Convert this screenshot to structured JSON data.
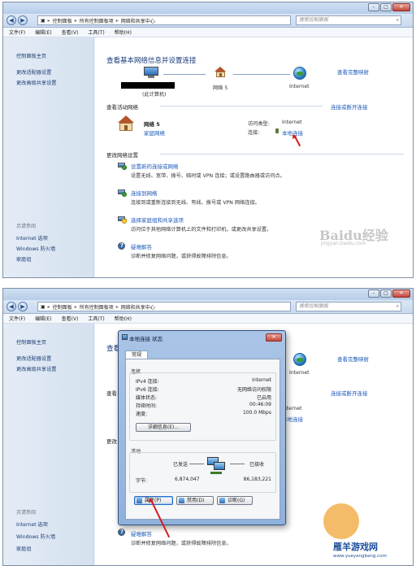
{
  "breadcrumb": [
    "控制面板",
    "所有控制面板项",
    "网络和共享中心"
  ],
  "search_placeholder": "搜索控制面板",
  "menu": [
    "文件(F)",
    "编辑(E)",
    "查看(V)",
    "工具(T)",
    "帮助(H)"
  ],
  "sidebar": {
    "home": "控制面板主页",
    "adapter_settings": "更改适配器设置",
    "advanced_sharing": "更改高级共享设置",
    "see_also_title": "另请参阅",
    "see_also": [
      "Internet 选项",
      "Windows 防火墙",
      "家庭组"
    ]
  },
  "main": {
    "heading": "查看基本网络信息并设置连接",
    "full_map": "查看完整映射",
    "map_nodes": [
      "(此计算机)",
      "网络 5",
      "Internet"
    ],
    "active_networks_title": "查看活动网络",
    "connect_disconnect": "连接或断开连接",
    "network_name": "网络 5",
    "network_type": "家庭网络",
    "access_type_label": "访问类型:",
    "access_type_value": "Internet",
    "connection_label": "连接:",
    "connection_value": "本地连接",
    "change_settings_title": "更改网络设置",
    "tasks": [
      {
        "title": "设置新的连接或网络",
        "desc": "设置无线、宽带、拨号、临时或 VPN 连接；或设置路由器或访问点。"
      },
      {
        "title": "连接到网络",
        "desc": "连接到或重新连接到无线、有线、拨号或 VPN 网络连接。"
      },
      {
        "title": "选择家庭组和共享选项",
        "desc": "访问位于其他网络计算机上的文件和打印机，或更改共享设置。"
      },
      {
        "title": "疑难解答",
        "desc": "诊断并修复网络问题，或获得故障排除信息。"
      }
    ]
  },
  "main2": {
    "heading_partial": "查看",
    "active_partial": "查看",
    "change_partial": "更改"
  },
  "dialog": {
    "title": "本地连接 状态",
    "tab": "常规",
    "connection_group": "连接",
    "rows": [
      {
        "label": "IPv4 连接:",
        "value": "Internet"
      },
      {
        "label": "IPv6 连接:",
        "value": "无网络访问权限"
      },
      {
        "label": "媒体状态:",
        "value": "已启用"
      },
      {
        "label": "持续时间:",
        "value": "00:46:09"
      },
      {
        "label": "速度:",
        "value": "100.0 Mbps"
      }
    ],
    "details_button": "详细信息(E)...",
    "activity_group": "活动",
    "sent_label": "已发送",
    "received_label": "已接收",
    "bytes_label": "字节:",
    "bytes_sent": "6,874,047",
    "bytes_received": "86,183,221",
    "properties_button": "属性(P)",
    "disable_button": "禁用(D)",
    "diagnose_button": "诊断(G)"
  },
  "watermarks": {
    "baidu": "Baidu经验",
    "baidu_url": "jingyan.baidu.com",
    "site": "雁羊游戏网",
    "site_url": "www.yueyangbang.com"
  },
  "colors": {
    "link": "#1b59b8",
    "heading": "#1a3a7a",
    "arrow": "#d61c1c"
  }
}
